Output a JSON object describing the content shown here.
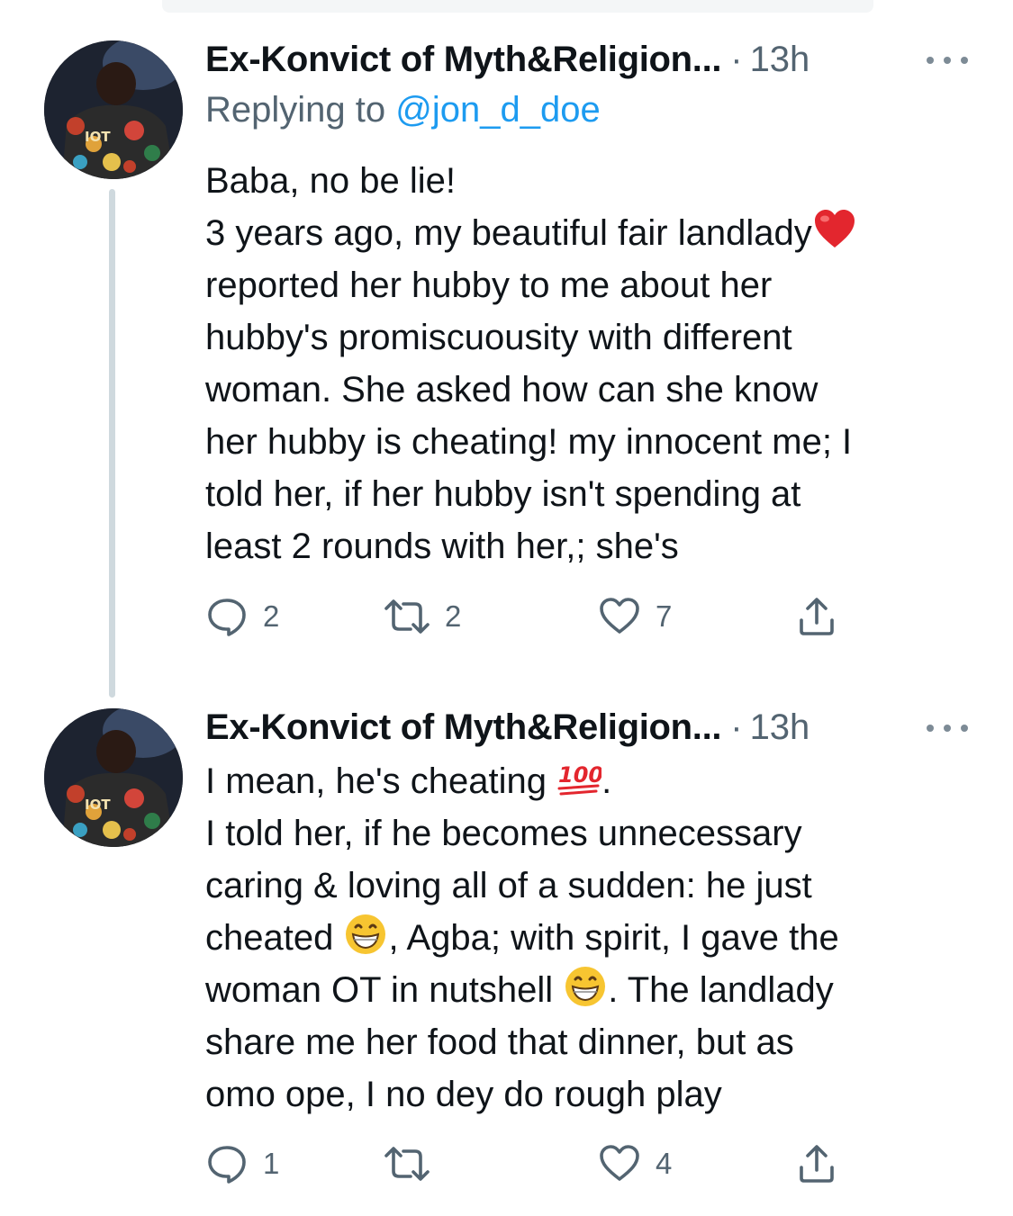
{
  "colors": {
    "text": "#0f1419",
    "secondary": "#536471",
    "link": "#1d9bf0",
    "thread_line": "#cfd9de",
    "heart_emoji": "#e3262e"
  },
  "tweets": [
    {
      "display_name": "Ex-Konvict of Myth&Religion...",
      "separator": "·",
      "time": "13h",
      "reply_prefix": "Replying to ",
      "reply_handle": "@jon_d_doe",
      "lines": [
        "Baba, no be lie!",
        "3 years ago, my beautiful fair landlady",
        "reported her hubby to me about her",
        "hubby's promiscuousity with different",
        "woman. She asked how can she know",
        "her hubby is cheating! my innocent me; I",
        "told her, if her hubby isn't spending at",
        "least 2 rounds with her,; she's"
      ],
      "emoji": [
        "red-heart-emoji"
      ],
      "stats": {
        "replies": "2",
        "retweets": "2",
        "likes": "7"
      }
    },
    {
      "display_name": "Ex-Konvict of Myth&Religion...",
      "separator": "·",
      "time": "13h",
      "lines": [
        {
          "a": "I mean, he's cheating ",
          "b": "."
        },
        {
          "a": "I told her, if he becomes unnecessary"
        },
        {
          "a": "caring & loving all of a sudden: he just"
        },
        {
          "a": "cheated ",
          "b": ", Agba; with spirit, I gave the"
        },
        {
          "a": "woman OT in nutshell ",
          "b": ". The landlady"
        },
        {
          "a": "share me her food that dinner, but as"
        },
        {
          "a": "omo ope, I no dey do rough play"
        }
      ],
      "emoji": [
        "hundred-points-emoji",
        "grinning-face-emoji",
        "grinning-face-emoji"
      ],
      "stats": {
        "replies": "1",
        "retweets": "",
        "likes": "4"
      }
    }
  ]
}
